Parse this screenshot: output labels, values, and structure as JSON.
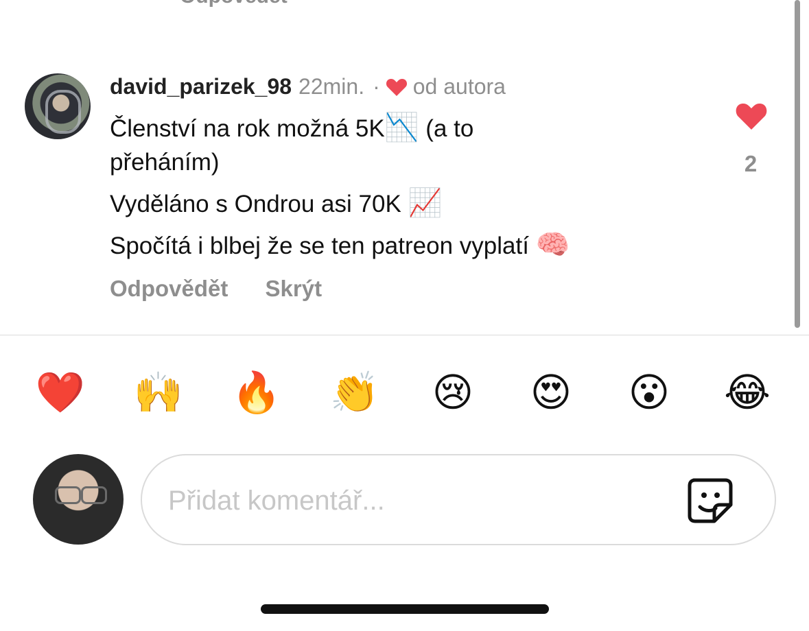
{
  "previous_comment": {
    "reply_label": "Odpovědět"
  },
  "comment": {
    "username": "david_parizek_98",
    "time": "22min.",
    "separator": "·",
    "author_liked_label": "od autora",
    "lines": [
      {
        "text": "Členství na rok možná 5K",
        "emoji": "📉",
        "suffix": " (a to"
      },
      {
        "text": "přeháním)"
      },
      {
        "text": "Vyděláno s Ondrou asi 70K ",
        "emoji": "📈"
      },
      {
        "text": "Spočítá i blbej že se ten patreon vyplatí ",
        "emoji": "🧠"
      }
    ],
    "reply_label": "Odpovědět",
    "hide_label": "Skrýt",
    "likes": "2"
  },
  "reactions": [
    "❤️",
    "🙌",
    "🔥",
    "👏",
    "😢",
    "😍",
    "😮",
    "😂"
  ],
  "input": {
    "placeholder": "Přidat komentář..."
  },
  "colors": {
    "heart": "#ed4956",
    "muted": "#8e8e8e",
    "divider": "#dbdbdb"
  }
}
